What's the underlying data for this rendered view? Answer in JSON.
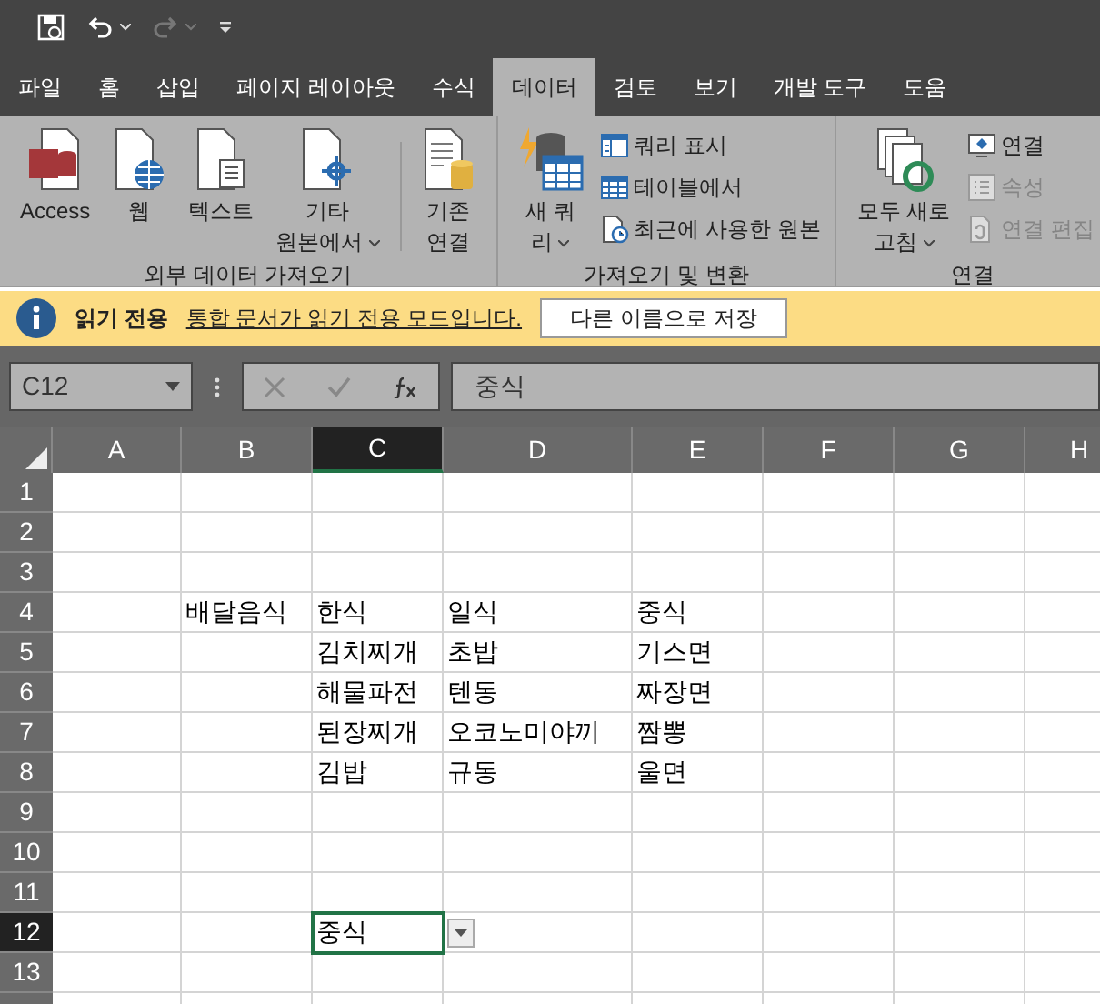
{
  "quick_access": {
    "redo_disabled": true
  },
  "tabs": [
    {
      "label": "파일",
      "selected": false
    },
    {
      "label": "홈",
      "selected": false
    },
    {
      "label": "삽입",
      "selected": false
    },
    {
      "label": "페이지 레이아웃",
      "selected": false
    },
    {
      "label": "수식",
      "selected": false
    },
    {
      "label": "데이터",
      "selected": true
    },
    {
      "label": "검토",
      "selected": false
    },
    {
      "label": "보기",
      "selected": false
    },
    {
      "label": "개발 도구",
      "selected": false
    },
    {
      "label": "도움",
      "selected": false
    }
  ],
  "ribbon_groups": [
    {
      "label": "외부 데이터 가져오기",
      "items": [
        {
          "kind": "large",
          "lines": [
            "Access"
          ],
          "dropdown": false,
          "disabled": false
        },
        {
          "kind": "large",
          "lines": [
            "웹"
          ],
          "dropdown": false,
          "disabled": false
        },
        {
          "kind": "large",
          "lines": [
            "텍스트"
          ],
          "dropdown": false,
          "disabled": false
        },
        {
          "kind": "large",
          "lines": [
            "기타",
            "원본에서"
          ],
          "dropdown": true,
          "disabled": false
        },
        {
          "kind": "divider"
        },
        {
          "kind": "large",
          "lines": [
            "기존",
            "연결"
          ],
          "dropdown": false,
          "disabled": false
        }
      ]
    },
    {
      "label": "가져오기 및 변환",
      "items": [
        {
          "kind": "large",
          "lines": [
            "새 쿼",
            "리"
          ],
          "dropdown": true,
          "disabled": false
        },
        {
          "kind": "stack",
          "entries": [
            {
              "label": "쿼리 표시",
              "disabled": false
            },
            {
              "label": "테이블에서",
              "disabled": false
            },
            {
              "label": "최근에 사용한 원본",
              "disabled": false
            }
          ]
        }
      ]
    },
    {
      "label": "연결",
      "items": [
        {
          "kind": "large",
          "lines": [
            "모두 새로",
            "고침"
          ],
          "dropdown": true,
          "disabled": false
        },
        {
          "kind": "stack",
          "entries": [
            {
              "label": "연결",
              "disabled": false
            },
            {
              "label": "속성",
              "disabled": true
            },
            {
              "label": "연결 편집",
              "disabled": true
            }
          ]
        }
      ]
    }
  ],
  "info_bar": {
    "title": "읽기 전용",
    "message": "통합 문서가 읽기 전용 모드입니다.",
    "button": "다른 이름으로 저장"
  },
  "formula_bar": {
    "name_box": "C12",
    "formula": "중식"
  },
  "sheet": {
    "columns": [
      {
        "label": "A",
        "selected": false
      },
      {
        "label": "B",
        "selected": false
      },
      {
        "label": "C",
        "selected": true
      },
      {
        "label": "D",
        "selected": false
      },
      {
        "label": "E",
        "selected": false
      },
      {
        "label": "F",
        "selected": false
      },
      {
        "label": "G",
        "selected": false
      },
      {
        "label": "H",
        "selected": false
      }
    ],
    "active_cell_dropdown": true,
    "rows": [
      {
        "label": "1",
        "selected": false
      },
      {
        "label": "2",
        "selected": false
      },
      {
        "label": "3",
        "selected": false
      },
      {
        "label": "4",
        "selected": false,
        "cells": [
          null,
          "배달음식",
          "한식",
          "일식",
          "중식"
        ]
      },
      {
        "label": "5",
        "selected": false,
        "cells": [
          null,
          null,
          "김치찌개",
          "초밥",
          "기스면"
        ]
      },
      {
        "label": "6",
        "selected": false,
        "cells": [
          null,
          null,
          "해물파전",
          "텐동",
          "짜장면"
        ]
      },
      {
        "label": "7",
        "selected": false,
        "cells": [
          null,
          null,
          "된장찌개",
          "오코노미야끼",
          "짬뽕"
        ]
      },
      {
        "label": "8",
        "selected": false,
        "cells": [
          null,
          null,
          "김밥",
          "규동",
          "울면"
        ]
      },
      {
        "label": "9",
        "selected": false
      },
      {
        "label": "10",
        "selected": false
      },
      {
        "label": "11",
        "selected": false
      },
      {
        "label": "12",
        "selected": true,
        "cells": [
          null,
          null,
          "중식"
        ]
      },
      {
        "label": "13",
        "selected": false
      }
    ]
  }
}
